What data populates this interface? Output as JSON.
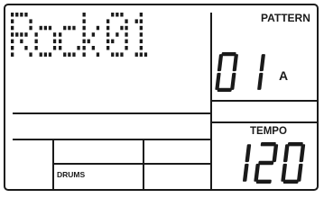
{
  "display": {
    "name_text": "Rock01",
    "pattern_label": "PATTERN",
    "pattern_number": "01",
    "pattern_variation": "A",
    "tempo_label": "TEMPO",
    "tempo_value": "120",
    "part_label": "DRUMS"
  },
  "colors": {
    "ink": "#1a1a1a",
    "background": "#ffffff"
  }
}
